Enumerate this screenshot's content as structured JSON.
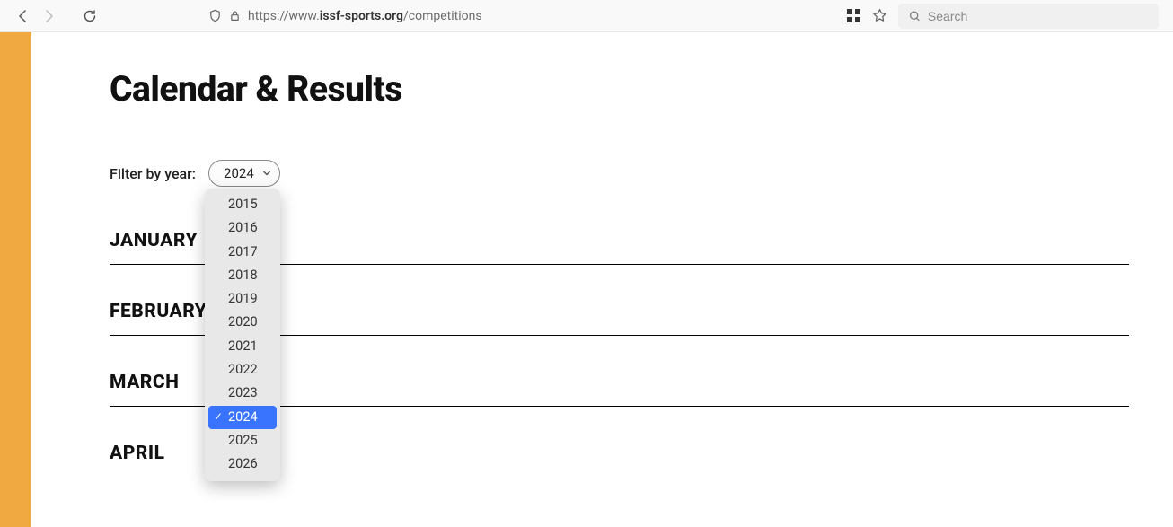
{
  "browser": {
    "url_prefix": "https://www.",
    "url_domain": "issf-sports.org",
    "url_path": "/competitions",
    "search_placeholder": "Search"
  },
  "page": {
    "title": "Calendar & Results",
    "filter_label": "Filter by year:",
    "selected_year": "2024"
  },
  "dropdown": {
    "options": [
      "2015",
      "2016",
      "2017",
      "2018",
      "2019",
      "2020",
      "2021",
      "2022",
      "2023",
      "2024",
      "2025",
      "2026"
    ],
    "selected": "2024"
  },
  "months": [
    "JANUARY",
    "FEBRUARY",
    "MARCH",
    "APRIL"
  ]
}
